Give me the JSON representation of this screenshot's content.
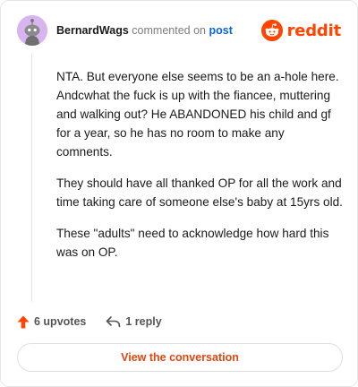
{
  "header": {
    "username": "BernardWags",
    "action_text": "commented on",
    "post_link": "post",
    "brand": "reddit"
  },
  "comment": {
    "paragraphs": [
      "NTA. But everyone else seems to be an a-hole here. Andcwhat the fuck is up with the fiancee, muttering and walking out? He ABANDONED his child and gf for a year, so he has no room to make any comnents.",
      "They should have all thanked OP for all the work and time taking care of someone else's baby at 15yrs old.",
      "These \"adults\" need to acknowledge how hard this was on OP."
    ]
  },
  "actions": {
    "upvotes": "6 upvotes",
    "reply": "1 reply"
  },
  "cta": {
    "label": "View the conversation"
  },
  "colors": {
    "brand": "#ff4500",
    "link": "#0a66d6",
    "avatar_bg": "#d8b4f0"
  },
  "icons": [
    "snoo-avatar-icon",
    "reddit-logo-icon",
    "upvote-arrow-icon",
    "reply-arrow-icon"
  ]
}
